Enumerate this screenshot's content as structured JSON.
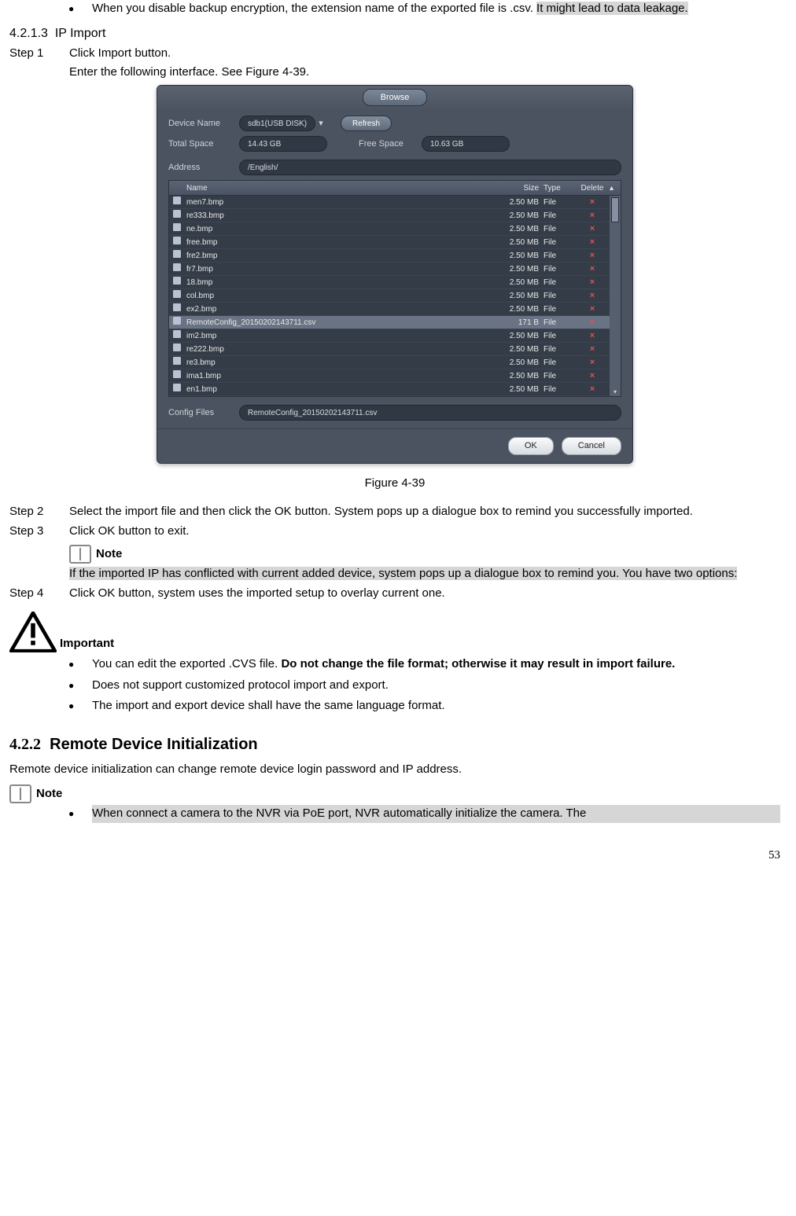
{
  "top_bullet": {
    "pre": "When you disable backup encryption, the extension name of the exported file is .csv. ",
    "hl": "It might lead to data leakage."
  },
  "sec4213": {
    "num": "4.2.1.3",
    "title": "IP Import"
  },
  "step1": {
    "lbl": "Step 1",
    "body": "Click Import button."
  },
  "step1b": "Enter the following interface. See Figure 4-39.",
  "fig_caption": "Figure 4-39",
  "step2": {
    "lbl": "Step 2",
    "body": "Select the import file and then click the OK button. System pops up a dialogue box to remind you successfully imported."
  },
  "step3": {
    "lbl": "Step 3",
    "body": "Click OK button to exit."
  },
  "note1_lbl": "Note",
  "note1_body": "If the imported IP has conflicted with current added device, system pops up a dialogue box to remind you. You have two options:",
  "step4": {
    "lbl": "Step 4",
    "body": "Click OK button, system uses the imported setup to overlay current one."
  },
  "important_lbl": "Important",
  "imp_b1_a": "You can edit the exported .CVS file. ",
  "imp_b1_b": "Do not change the file format; otherwise it may result in import failure.",
  "imp_b2": "Does not support customized protocol import and export.",
  "imp_b3": "The import and export device shall have the same language format.",
  "sec422": {
    "num": "4.2.2",
    "title": "Remote Device Initialization"
  },
  "sec422_intro": "Remote device initialization can change remote device login password and IP address.",
  "note2_lbl": "Note",
  "bottom_bullet": "When connect a camera to the NVR via PoE port, NVR automatically initialize the camera. The",
  "pagenum": "53",
  "dialog": {
    "tab": "Browse",
    "device_name_lbl": "Device Name",
    "device_name_val": "sdb1(USB DISK)",
    "refresh": "Refresh",
    "total_space_lbl": "Total Space",
    "total_space_val": "14.43 GB",
    "free_space_lbl": "Free Space",
    "free_space_val": "10.63 GB",
    "address_lbl": "Address",
    "address_val": "/English/",
    "cols": {
      "name": "Name",
      "size": "Size",
      "type": "Type",
      "del": "Delete"
    },
    "rows": [
      {
        "name": "men7.bmp",
        "size": "2.50 MB",
        "type": "File"
      },
      {
        "name": "re333.bmp",
        "size": "2.50 MB",
        "type": "File"
      },
      {
        "name": "ne.bmp",
        "size": "2.50 MB",
        "type": "File"
      },
      {
        "name": "free.bmp",
        "size": "2.50 MB",
        "type": "File"
      },
      {
        "name": "fre2.bmp",
        "size": "2.50 MB",
        "type": "File"
      },
      {
        "name": "fr7.bmp",
        "size": "2.50 MB",
        "type": "File"
      },
      {
        "name": "18.bmp",
        "size": "2.50 MB",
        "type": "File"
      },
      {
        "name": "col.bmp",
        "size": "2.50 MB",
        "type": "File"
      },
      {
        "name": "ex2.bmp",
        "size": "2.50 MB",
        "type": "File"
      },
      {
        "name": "RemoteConfig_20150202143711.csv",
        "size": "171 B",
        "type": "File",
        "sel": true
      },
      {
        "name": "im2.bmp",
        "size": "2.50 MB",
        "type": "File"
      },
      {
        "name": "re222.bmp",
        "size": "2.50 MB",
        "type": "File"
      },
      {
        "name": "re3.bmp",
        "size": "2.50 MB",
        "type": "File"
      },
      {
        "name": "ima1.bmp",
        "size": "2.50 MB",
        "type": "File"
      },
      {
        "name": "en1.bmp",
        "size": "2.50 MB",
        "type": "File"
      }
    ],
    "config_files_lbl": "Config Files",
    "config_files_val": "RemoteConfig_20150202143711.csv",
    "ok": "OK",
    "cancel": "Cancel"
  }
}
